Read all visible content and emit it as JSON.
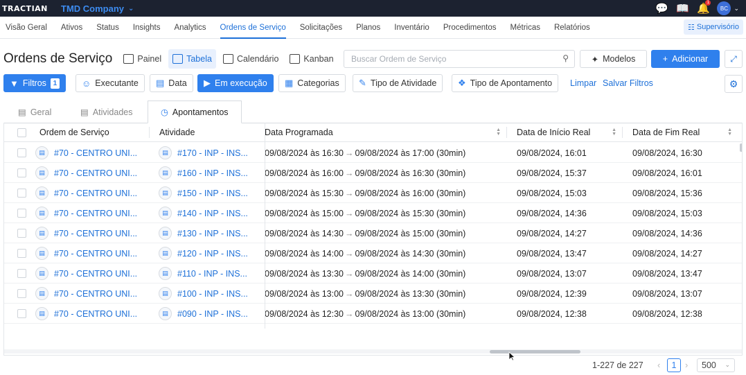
{
  "app": {
    "logo": "TRACTIAN",
    "company": "TMD Company",
    "notification_count": "1",
    "avatar_initials": "BC"
  },
  "nav": {
    "items": [
      "Visão Geral",
      "Ativos",
      "Status",
      "Insights",
      "Analytics",
      "Ordens de Serviço",
      "Solicitações",
      "Planos",
      "Inventário",
      "Procedimentos",
      "Métricas",
      "Relatórios"
    ],
    "active": "Ordens de Serviço",
    "supervisor": "Supervisório"
  },
  "header": {
    "title": "Ordens de Serviço",
    "views": [
      "Painel",
      "Tabela",
      "Calendário",
      "Kanban"
    ],
    "active_view": "Tabela",
    "search_placeholder": "Buscar Ordem de Serviço",
    "models_label": "Modelos",
    "add_label": "Adicionar"
  },
  "filters": {
    "filters_label": "Filtros",
    "filters_count": "1",
    "executante": "Executante",
    "data": "Data",
    "em_execucao": "Em execução",
    "categorias": "Categorias",
    "tipo_atividade": "Tipo de Atividade",
    "tipo_apontamento": "Tipo de Apontamento",
    "limpar": "Limpar",
    "salvar": "Salvar Filtros"
  },
  "tabs": [
    "Geral",
    "Atividades",
    "Apontamentos"
  ],
  "active_tab": "Apontamentos",
  "table": {
    "columns": [
      "Ordem de Serviço",
      "Atividade",
      "Data Programada",
      "Data de Início Real",
      "Data de Fim Real"
    ],
    "rows": [
      {
        "os": "#70 - CENTRO UNI...",
        "activity": "#170 - INP - INS...",
        "sched_start": "09/08/2024 às 16:30",
        "sched_end": "09/08/2024 às 17:00 (30min)",
        "start": "09/08/2024, 16:01",
        "end": "09/08/2024, 16:30"
      },
      {
        "os": "#70 - CENTRO UNI...",
        "activity": "#160 - INP - INS...",
        "sched_start": "09/08/2024 às 16:00",
        "sched_end": "09/08/2024 às 16:30 (30min)",
        "start": "09/08/2024, 15:37",
        "end": "09/08/2024, 16:01"
      },
      {
        "os": "#70 - CENTRO UNI...",
        "activity": "#150 - INP - INS...",
        "sched_start": "09/08/2024 às 15:30",
        "sched_end": "09/08/2024 às 16:00 (30min)",
        "start": "09/08/2024, 15:03",
        "end": "09/08/2024, 15:36"
      },
      {
        "os": "#70 - CENTRO UNI...",
        "activity": "#140 - INP - INS...",
        "sched_start": "09/08/2024 às 15:00",
        "sched_end": "09/08/2024 às 15:30 (30min)",
        "start": "09/08/2024, 14:36",
        "end": "09/08/2024, 15:03"
      },
      {
        "os": "#70 - CENTRO UNI...",
        "activity": "#130 - INP - INS...",
        "sched_start": "09/08/2024 às 14:30",
        "sched_end": "09/08/2024 às 15:00 (30min)",
        "start": "09/08/2024, 14:27",
        "end": "09/08/2024, 14:36"
      },
      {
        "os": "#70 - CENTRO UNI...",
        "activity": "#120 - INP - INS...",
        "sched_start": "09/08/2024 às 14:00",
        "sched_end": "09/08/2024 às 14:30 (30min)",
        "start": "09/08/2024, 13:47",
        "end": "09/08/2024, 14:27"
      },
      {
        "os": "#70 - CENTRO UNI...",
        "activity": "#110 - INP - INS...",
        "sched_start": "09/08/2024 às 13:30",
        "sched_end": "09/08/2024 às 14:00 (30min)",
        "start": "09/08/2024, 13:07",
        "end": "09/08/2024, 13:47"
      },
      {
        "os": "#70 - CENTRO UNI...",
        "activity": "#100 - INP - INS...",
        "sched_start": "09/08/2024 às 13:00",
        "sched_end": "09/08/2024 às 13:30 (30min)",
        "start": "09/08/2024, 12:39",
        "end": "09/08/2024, 13:07"
      },
      {
        "os": "#70 - CENTRO UNI...",
        "activity": "#090 - INP - INS...",
        "sched_start": "09/08/2024 às 12:30",
        "sched_end": "09/08/2024 às 13:00 (30min)",
        "start": "09/08/2024, 12:38",
        "end": "09/08/2024, 12:38"
      }
    ]
  },
  "pagination": {
    "range": "1-227 de 227",
    "current_page": "1",
    "page_size": "500"
  },
  "colors": {
    "accent": "#2f80ed",
    "topbar": "#1c2230",
    "link": "#1d70d8"
  }
}
